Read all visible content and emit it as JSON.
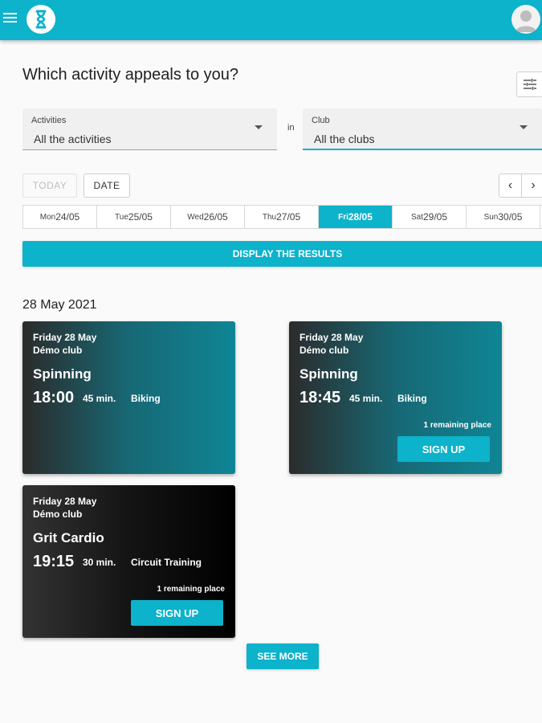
{
  "colors": {
    "brand": "#0db2cb"
  },
  "header": {
    "menu_icon": "menu-icon",
    "logo_icon": "hourglass-logo-icon",
    "avatar_icon": "user-avatar-icon"
  },
  "page": {
    "title": "Which activity appeals to you?",
    "filter_icon": "tune-icon"
  },
  "filters": {
    "activities": {
      "label": "Activities",
      "value": "All the activities"
    },
    "in_label": "in",
    "club": {
      "label": "Club",
      "value": "All the clubs"
    }
  },
  "date_controls": {
    "today": "TODAY",
    "date": "DATE",
    "prev": "‹",
    "next": "›"
  },
  "days": [
    {
      "name": "Mon",
      "date": "24/05",
      "selected": false
    },
    {
      "name": "Tue",
      "date": "25/05",
      "selected": false
    },
    {
      "name": "Wed",
      "date": "26/05",
      "selected": false
    },
    {
      "name": "Thu",
      "date": "27/05",
      "selected": false
    },
    {
      "name": "Fri",
      "date": "28/05",
      "selected": true
    },
    {
      "name": "Sat",
      "date": "29/05",
      "selected": false
    },
    {
      "name": "Sun",
      "date": "30/05",
      "selected": false
    }
  ],
  "display_button": "DISPLAY THE RESULTS",
  "results_date": "28 May 2021",
  "sessions": [
    {
      "day": "Friday 28 May",
      "club": "Démo club",
      "name": "Spinning",
      "time": "18:00",
      "duration": "45 min.",
      "type": "Biking",
      "remaining": "",
      "signup": ""
    },
    {
      "day": "Friday 28 May",
      "club": "Démo club",
      "name": "Spinning",
      "time": "18:45",
      "duration": "45 min.",
      "type": "Biking",
      "remaining": "1 remaining place",
      "signup": "SIGN UP"
    },
    {
      "day": "Friday 28 May",
      "club": "Démo club",
      "name": "Grit Cardio",
      "time": "19:15",
      "duration": "30 min.",
      "type": "Circuit Training",
      "remaining": "1 remaining place",
      "signup": "SIGN UP"
    }
  ],
  "see_more": "SEE MORE"
}
